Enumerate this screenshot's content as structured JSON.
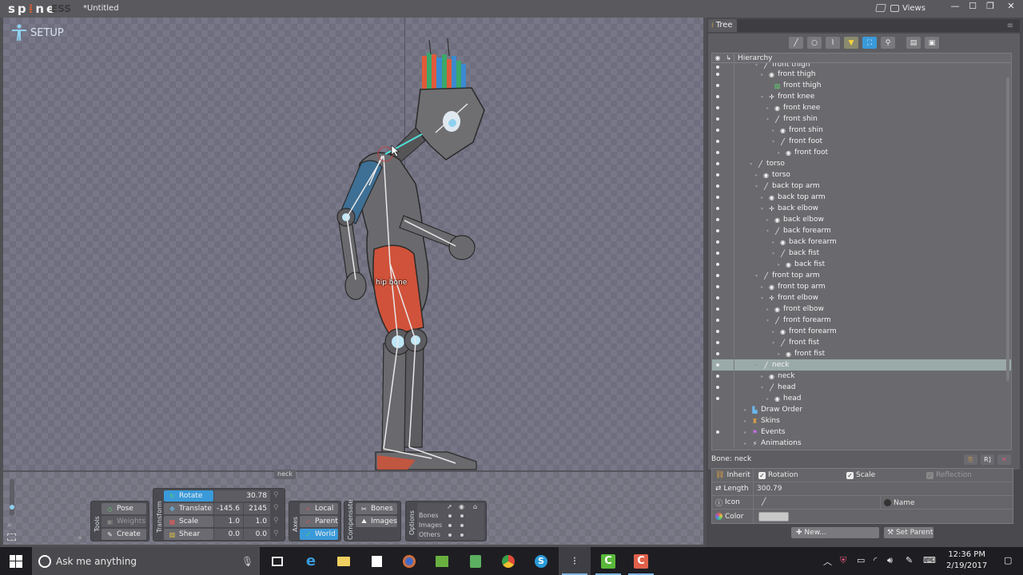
{
  "app": {
    "logo": "sp ne",
    "edition": "ESS",
    "document_title": "*Untitled",
    "views_label": "Views",
    "window_controls": [
      "minimize",
      "maximize",
      "restore",
      "close"
    ]
  },
  "viewport": {
    "mode": "SETUP",
    "hover_bone_label": "hip bone",
    "selected_bone_tag": "neck"
  },
  "tools": {
    "title": "Tools",
    "items": [
      {
        "label": "Pose",
        "icon": "pose-icon",
        "state": "normal"
      },
      {
        "label": "Weights",
        "icon": "weights-icon",
        "state": "disabled"
      },
      {
        "label": "Create",
        "icon": "create-icon",
        "state": "normal"
      }
    ]
  },
  "transform": {
    "title": "Transform",
    "rows": [
      {
        "label": "Rotate",
        "icon": "rotate-icon",
        "active": true,
        "values": [
          "30.78"
        ]
      },
      {
        "label": "Translate",
        "icon": "translate-icon",
        "active": false,
        "values": [
          "-145.6",
          "2145"
        ]
      },
      {
        "label": "Scale",
        "icon": "scale-icon",
        "active": false,
        "values": [
          "1.0",
          "1.0"
        ]
      },
      {
        "label": "Shear",
        "icon": "shear-icon",
        "active": false,
        "values": [
          "0.0",
          "0.0"
        ]
      }
    ]
  },
  "axes": {
    "title": "Axes",
    "items": [
      {
        "label": "Local",
        "active": false
      },
      {
        "label": "Parent",
        "active": false
      },
      {
        "label": "World",
        "active": true
      }
    ]
  },
  "compensate": {
    "title": "Compensate",
    "items": [
      {
        "label": "Bones"
      },
      {
        "label": "Images"
      }
    ]
  },
  "options": {
    "title": "Options",
    "rows": [
      "Bones",
      "Images",
      "Others"
    ]
  },
  "tree": {
    "tab_label": "Tree",
    "column_header": "Hierarchy",
    "toolbar": [
      "bone-filter",
      "slot-filter",
      "attachment-filter",
      "filter",
      "focus",
      "search",
      "collapse",
      "expand"
    ],
    "rows": [
      {
        "label": "front thigh",
        "type": "bone",
        "depth": 4,
        "visible": true,
        "partial": true
      },
      {
        "label": "front thigh",
        "type": "slot",
        "depth": 5,
        "visible": true
      },
      {
        "label": "front thigh",
        "type": "image",
        "depth": 6,
        "visible": true
      },
      {
        "label": "front knee",
        "type": "ik",
        "depth": 5,
        "visible": true
      },
      {
        "label": "front knee",
        "type": "slot",
        "depth": 6,
        "visible": true
      },
      {
        "label": "front shin",
        "type": "bone",
        "depth": 6,
        "visible": true
      },
      {
        "label": "front shin",
        "type": "slot",
        "depth": 7,
        "visible": true
      },
      {
        "label": "front foot",
        "type": "bone",
        "depth": 7,
        "visible": true
      },
      {
        "label": "front foot",
        "type": "slot",
        "depth": 8,
        "visible": true
      },
      {
        "label": "torso",
        "type": "bone",
        "depth": 3,
        "visible": true
      },
      {
        "label": "torso",
        "type": "slot",
        "depth": 4,
        "visible": true
      },
      {
        "label": "back top arm",
        "type": "bone",
        "depth": 4,
        "visible": true
      },
      {
        "label": "back top arm",
        "type": "slot",
        "depth": 5,
        "visible": true
      },
      {
        "label": "back elbow",
        "type": "ik",
        "depth": 5,
        "visible": true
      },
      {
        "label": "back elbow",
        "type": "slot",
        "depth": 6,
        "visible": true
      },
      {
        "label": "back forearm",
        "type": "bone",
        "depth": 6,
        "visible": true
      },
      {
        "label": "back forearm",
        "type": "slot",
        "depth": 7,
        "visible": true
      },
      {
        "label": "back fist",
        "type": "bone",
        "depth": 7,
        "visible": true
      },
      {
        "label": "back fist",
        "type": "slot",
        "depth": 8,
        "visible": true
      },
      {
        "label": "front top arm",
        "type": "bone",
        "depth": 4,
        "visible": true
      },
      {
        "label": "front top arm",
        "type": "slot",
        "depth": 5,
        "visible": true
      },
      {
        "label": "front elbow",
        "type": "ik",
        "depth": 5,
        "visible": true
      },
      {
        "label": "front elbow",
        "type": "slot",
        "depth": 6,
        "visible": true
      },
      {
        "label": "front forearm",
        "type": "bone",
        "depth": 6,
        "visible": true
      },
      {
        "label": "front forearm",
        "type": "slot",
        "depth": 7,
        "visible": true
      },
      {
        "label": "front fist",
        "type": "bone",
        "depth": 7,
        "visible": true
      },
      {
        "label": "front fist",
        "type": "slot",
        "depth": 8,
        "visible": true
      },
      {
        "label": "neck",
        "type": "bone",
        "depth": 4,
        "visible": true,
        "selected": true
      },
      {
        "label": "neck",
        "type": "slot",
        "depth": 5,
        "visible": true
      },
      {
        "label": "head",
        "type": "bone",
        "depth": 5,
        "visible": true
      },
      {
        "label": "head",
        "type": "slot",
        "depth": 6,
        "visible": true
      },
      {
        "label": "Draw Order",
        "type": "draworder",
        "depth": 2,
        "visible": false
      },
      {
        "label": "Skins",
        "type": "skins",
        "depth": 2,
        "visible": false
      },
      {
        "label": "Events",
        "type": "events",
        "depth": 2,
        "visible": true
      },
      {
        "label": "Animations",
        "type": "animations",
        "depth": 2,
        "visible": false
      }
    ]
  },
  "bone_properties": {
    "title": "Bone: neck",
    "inherit_label": "Inherit",
    "inherit": [
      {
        "label": "Rotation",
        "checked": true,
        "enabled": true
      },
      {
        "label": "Scale",
        "checked": true,
        "enabled": true
      },
      {
        "label": "Reflection",
        "checked": true,
        "enabled": false
      }
    ],
    "length_label": "Length",
    "length": "300.79",
    "icon_label": "Icon",
    "name_label": "Name",
    "color_label": "Color",
    "color": "#c8c8c8",
    "new_button": "New...",
    "set_parent_button": "Set Parent"
  },
  "taskbar": {
    "search_placeholder": "Ask me anything",
    "apps": [
      "task-view",
      "edge",
      "file-explorer",
      "store",
      "firefox",
      "photos",
      "notes",
      "chrome",
      "skype",
      "spine",
      "camtasia-green",
      "camtasia-red"
    ],
    "time": "12:36 PM",
    "date": "2/19/2017"
  },
  "colors": {
    "accent": "#3a9ad9",
    "selection": "#9aaaa8",
    "logo_accent": "#e05a2e"
  }
}
